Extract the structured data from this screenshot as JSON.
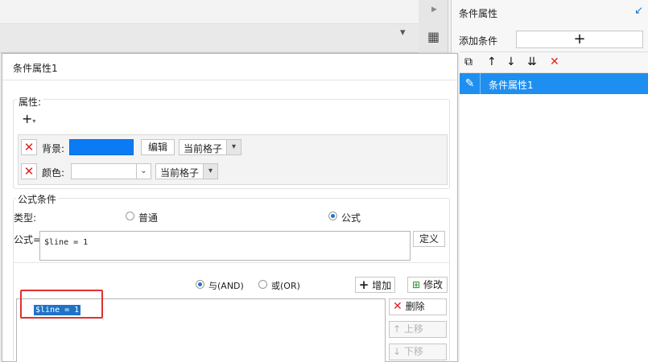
{
  "right_panel": {
    "title": "条件属性",
    "add_condition_label": "添加条件",
    "add_button_symbol": "+",
    "conditions": [
      {
        "label": "条件属性1"
      }
    ]
  },
  "dialog": {
    "title": "条件属性1",
    "attributes": {
      "legend": "属性:",
      "rows": [
        {
          "label": "背景:",
          "color": "#0a7bf4",
          "edit_button": "编辑",
          "scope": "当前格子"
        },
        {
          "label": "颜色:",
          "color_value": "",
          "scope": "当前格子"
        }
      ]
    },
    "formula_condition": {
      "legend": "公式条件",
      "type_label": "类型:",
      "type_options": [
        {
          "label": "普通",
          "selected": false
        },
        {
          "label": "公式",
          "selected": true
        }
      ],
      "formula_label": "公式=",
      "formula_value": "$line = 1",
      "define_button": "定义",
      "logic_options": [
        {
          "label": "与(AND)",
          "selected": true
        },
        {
          "label": "或(OR)",
          "selected": false
        }
      ],
      "add_button": "增加",
      "modify_button": "修改",
      "conditions": [
        "$line = 1"
      ],
      "delete_button": "删除",
      "move_up_button": "上移",
      "move_down_button": "下移"
    }
  },
  "colors": {
    "accent": "#1e8ff0",
    "swatch_blue": "#0a7bf4",
    "highlight_red": "#e22f2f"
  }
}
